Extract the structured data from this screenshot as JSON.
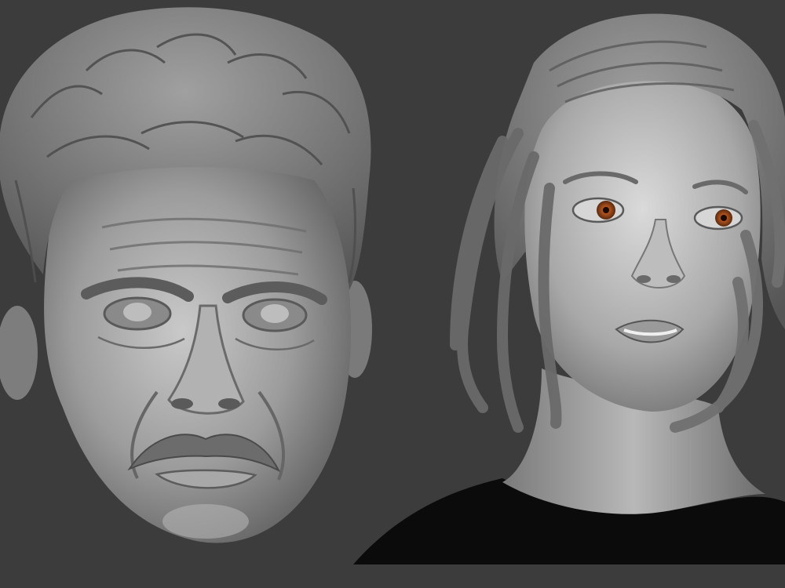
{
  "scene": {
    "background_color": "#3c3c3c",
    "sculpt_base_color": "#9a9a9a",
    "sculpt_shadow_color": "#5e5e5e",
    "sculpt_highlight_color": "#d8d8d8",
    "eye_color": "#b0521c",
    "shirt_color": "#0b0b0b"
  },
  "models": [
    {
      "name": "male-head-sculpt",
      "features": [
        "curly-hair",
        "mustache",
        "furrowed-brow"
      ]
    },
    {
      "name": "female-bust-sculpt",
      "features": [
        "wavy-hair",
        "amber-eyes",
        "black-shirt"
      ]
    }
  ]
}
